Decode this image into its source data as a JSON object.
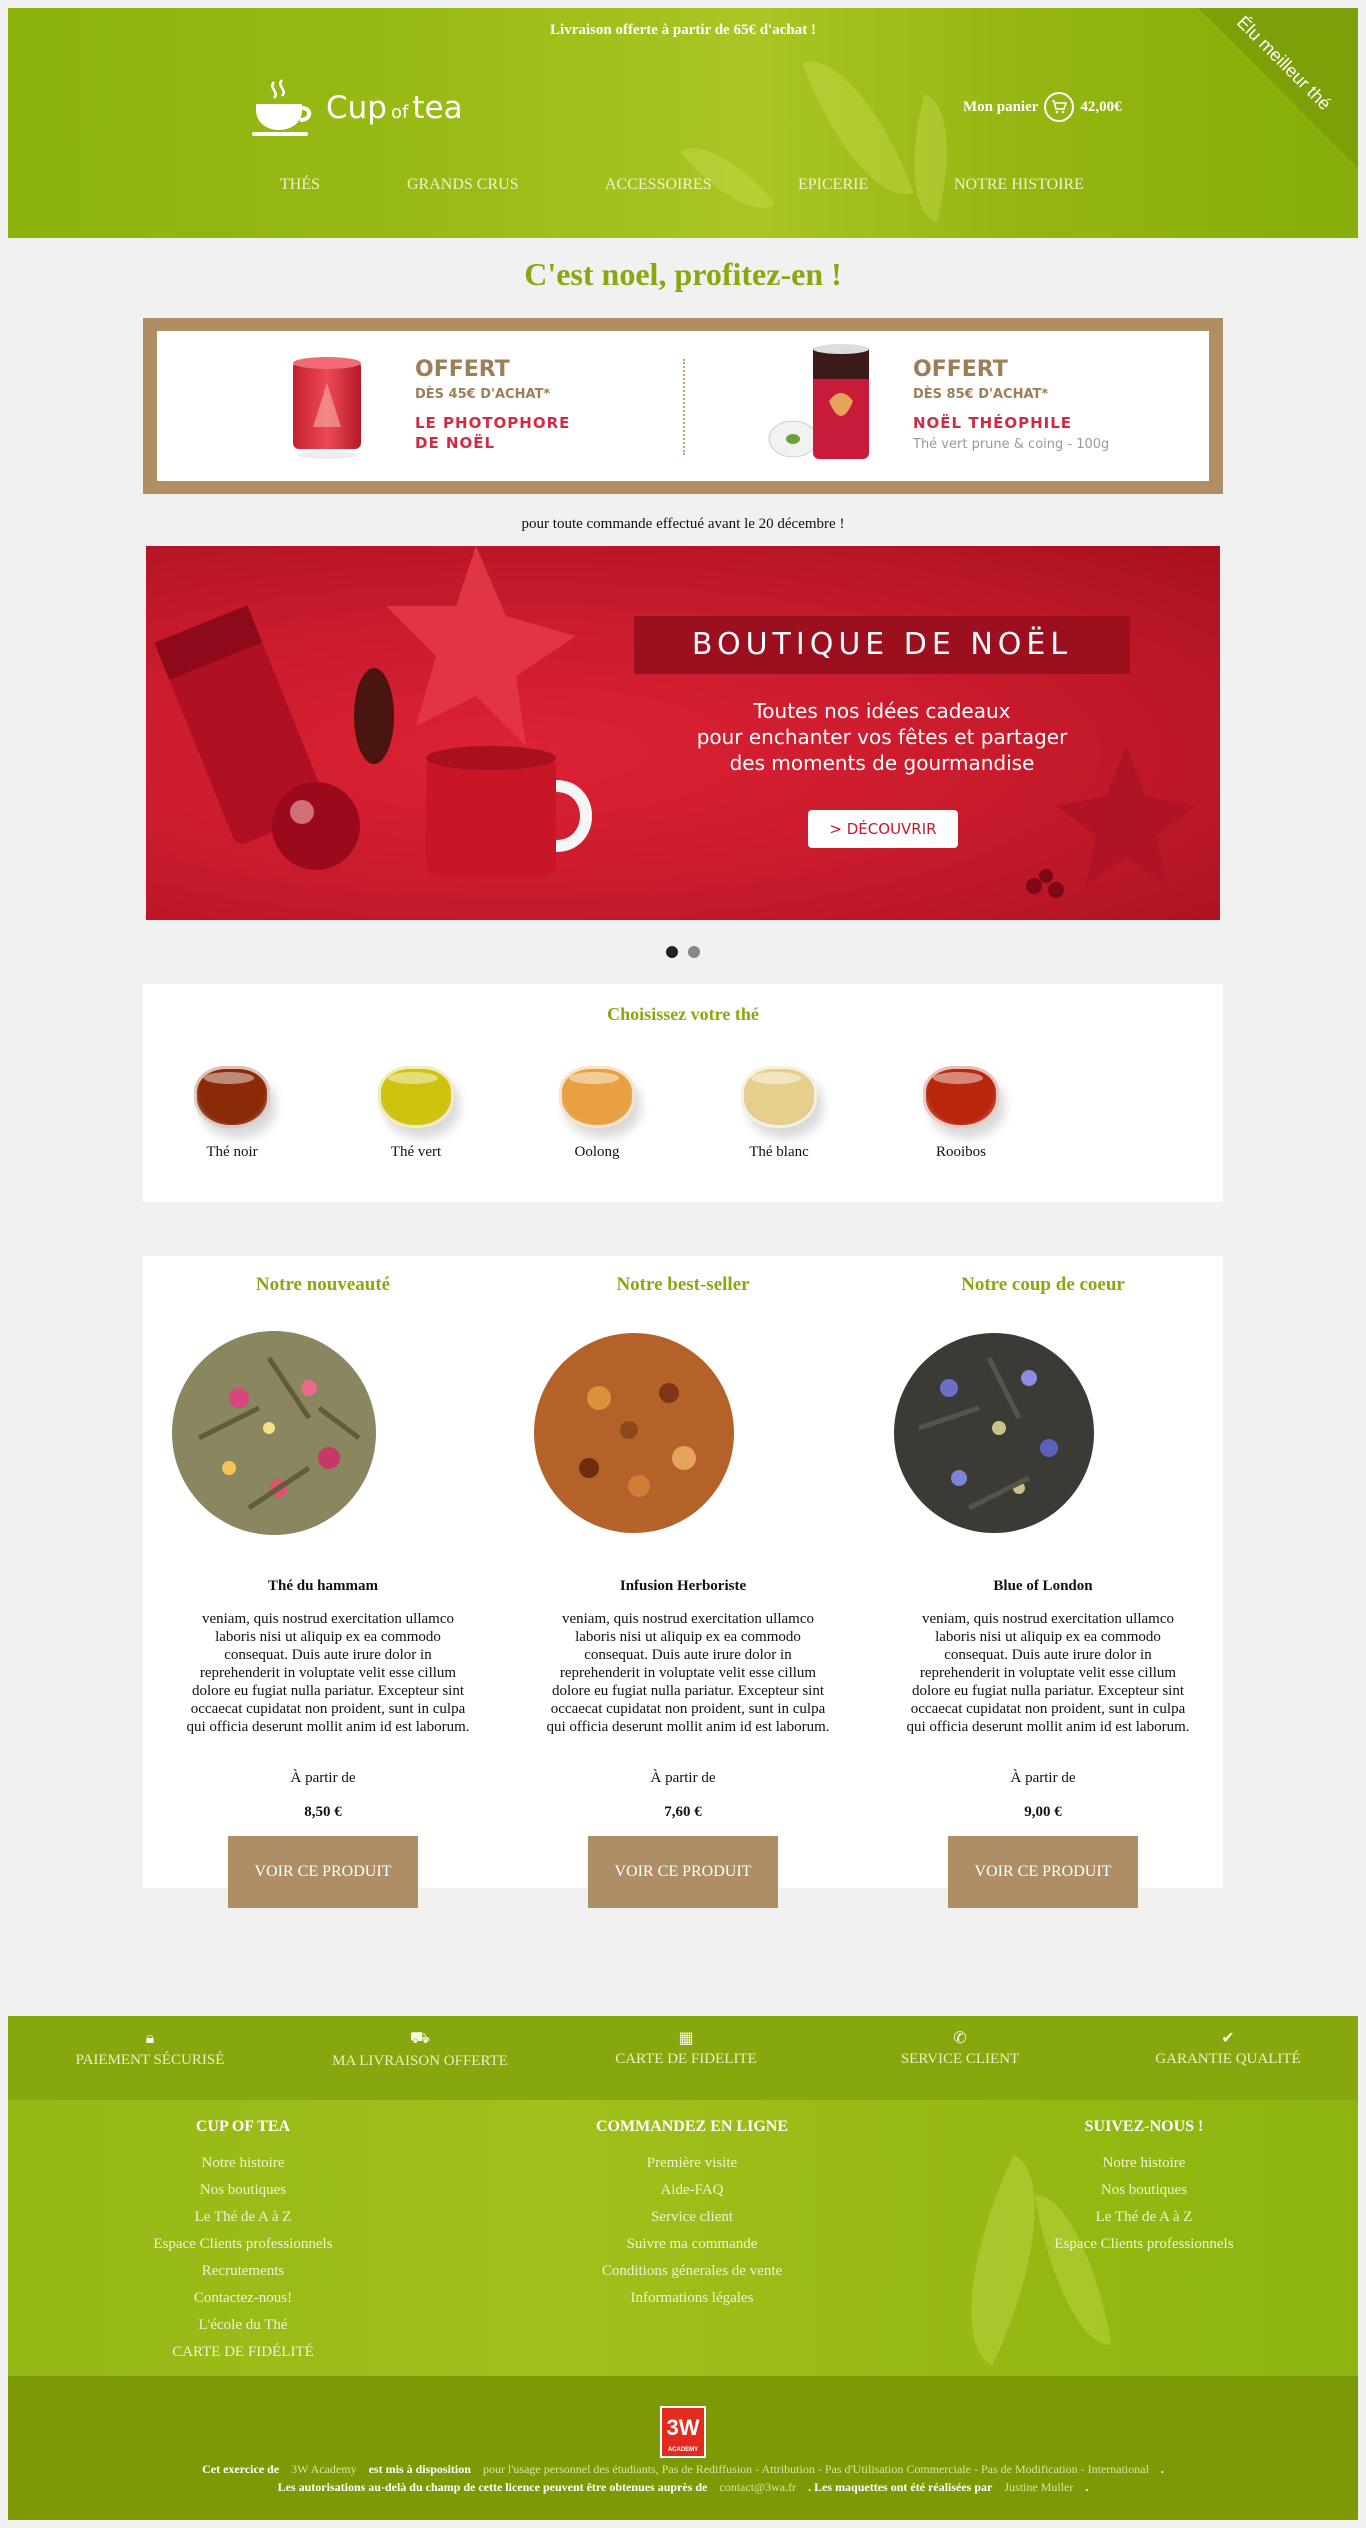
{
  "header": {
    "shipping_note": "Livraison offerte à partir de 65€ d'achat !",
    "logo": {
      "main": "Cup",
      "of": "of",
      "tea": "tea"
    },
    "cart": {
      "label": "Mon panier",
      "amount": "42,00€"
    },
    "ribbon": "Élu meilleur thé",
    "nav": [
      "THÉS",
      "GRANDS CRUS",
      "ACCESSOIRES",
      "EPICERIE",
      "NOTRE HISTOIRE"
    ]
  },
  "promo": {
    "title": "C'est noel, profitez-en !",
    "offer1": {
      "big": "OFFERT",
      "small": "DÈS 45€ D'ACHAT*",
      "name1": "LE PHOTOPHORE",
      "name2": "DE NOËL"
    },
    "offer2": {
      "big": "OFFERT",
      "small": "DÈS 85€ D'ACHAT*",
      "name1": "NOËL THÉOPHILE",
      "desc": "Thé vert prune & coing - 100g"
    },
    "note": "pour toute commande effectué avant le 20 décembre !"
  },
  "slider": {
    "title": "BOUTIQUE DE NOËL",
    "line1": "Toutes nos idées cadeaux",
    "line2": "pour enchanter vos fêtes et partager",
    "line3": "des moments de gourmandise",
    "button": "> DÉCOUVRIR"
  },
  "choose": {
    "title": "Choisissez votre thé",
    "teas": [
      {
        "label": "Thé noir",
        "color": "#8a2a08"
      },
      {
        "label": "Thé vert",
        "color": "#cfc20e"
      },
      {
        "label": "Oolong",
        "color": "#e9a040"
      },
      {
        "label": "Thé blanc",
        "color": "#e6cf8c"
      },
      {
        "label": "Rooibos",
        "color": "#b8260c"
      }
    ]
  },
  "products": [
    {
      "heading": "Notre nouveauté",
      "name": "Thé du hammam",
      "desc": "veniam, quis nostrud exercitation ullamco laboris nisi ut aliquip ex ea commodo consequat. Duis aute irure dolor in reprehenderit in voluptate velit esse cillum dolore eu fugiat nulla pariatur. Excepteur sint occaecat cupidatat non proident, sunt in culpa qui officia deserunt mollit anim id est laborum.",
      "from": "À partir de",
      "price": "8,50 €",
      "button": "VOIR CE PRODUIT"
    },
    {
      "heading": "Notre best-seller",
      "name": "Infusion Herboriste",
      "desc": "veniam, quis nostrud exercitation ullamco laboris nisi ut aliquip ex ea commodo consequat. Duis aute irure dolor in reprehenderit in voluptate velit esse cillum dolore eu fugiat nulla pariatur. Excepteur sint occaecat cupidatat non proident, sunt in culpa qui officia deserunt mollit anim id est laborum.",
      "from": "À partir de",
      "price": "7,60 €",
      "button": "VOIR CE PRODUIT"
    },
    {
      "heading": "Notre coup de coeur",
      "name": "Blue of London",
      "desc": "veniam, quis nostrud exercitation ullamco laboris nisi ut aliquip ex ea commodo consequat. Duis aute irure dolor in reprehenderit in voluptate velit esse cillum dolore eu fugiat nulla pariatur. Excepteur sint occaecat cupidatat non proident, sunt in culpa qui officia deserunt mollit anim id est laborum.",
      "from": "À partir de",
      "price": "9,00 €",
      "button": "VOIR CE PRODUIT"
    }
  ],
  "features": [
    "PAIEMENT SÉCURISÉ",
    "MA LIVRAISON OFFERTE",
    "CARTE DE FIDELITE",
    "SERVICE CLIENT",
    "GARANTIE QUALITÉ"
  ],
  "footer": {
    "col1": {
      "title": "CUP OF TEA",
      "links": [
        "Notre histoire",
        "Nos boutiques",
        "Le Thé de A à Z",
        "Espace Clients professionnels",
        "Recrutements",
        "Contactez-nous!",
        "L'école du Thé",
        "CARTE DE FIDÉLITÉ"
      ]
    },
    "col2": {
      "title": "COMMANDEZ EN LIGNE",
      "links": [
        "Première visite",
        "Aide-FAQ",
        "Service client",
        "Suivre ma commande",
        "Conditions génerales de vente",
        "Informations légales"
      ]
    },
    "col3": {
      "title": "SUIVEZ-NOUS !",
      "links": [
        "Notre histoire",
        "Nos boutiques",
        "Le Thé de A à Z",
        "Espace Clients professionnels"
      ]
    }
  },
  "credits": {
    "badge": "3W",
    "badge_small": "ACADEMY",
    "l1a": "Cet exercice de",
    "l1b": "3W Academy",
    "l1c": "est mis à disposition",
    "l1d": "pour l'usage personnel des étudiants, Pas de Rediffusion - Attribution - Pas d'Utilisation Commerciale - Pas de Modification - International",
    "l1e": ".",
    "l2a": "Les autorisations au-delà du champ de cette licence peuvent être obtenues auprès de",
    "l2b": "contact@3wa.fr",
    "l2c": ". Les maquettes ont été réalisées par",
    "l2d": "Justine Muller",
    "l2e": "."
  }
}
